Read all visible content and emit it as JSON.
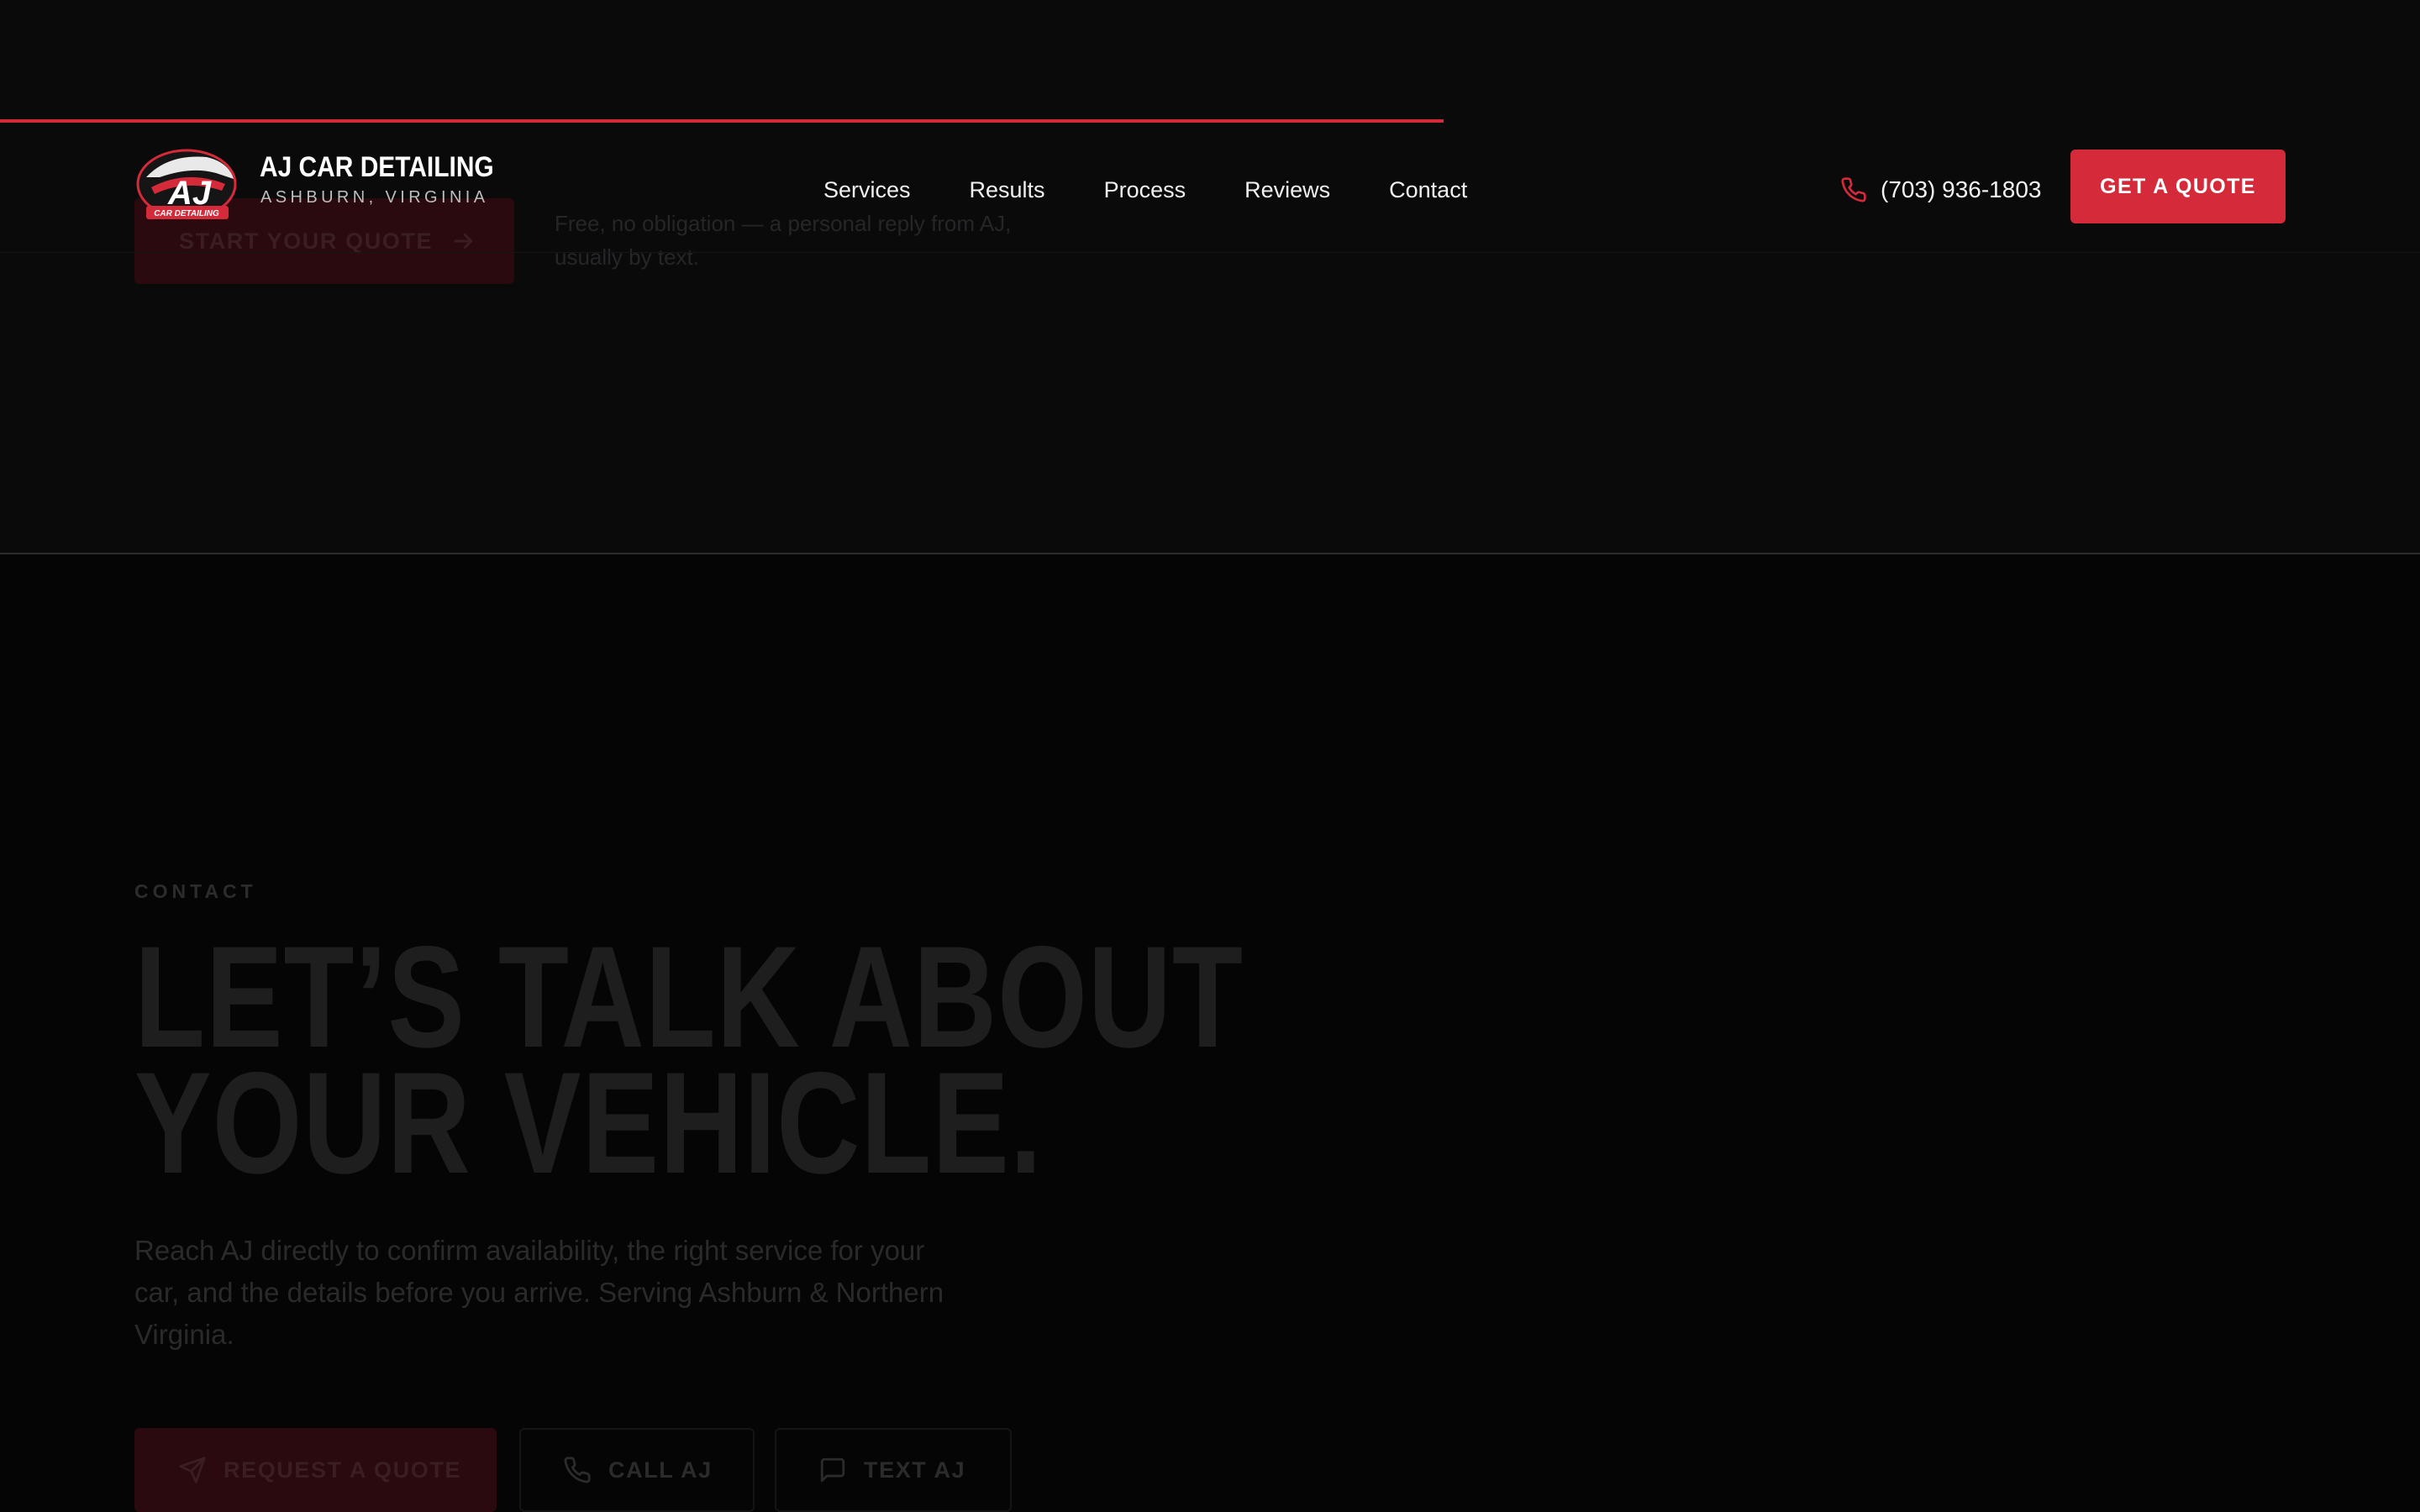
{
  "colors": {
    "accent": "#d42a3a",
    "background_top": "#0b0a0b",
    "background_bottom": "#050505"
  },
  "scroll_progress": 0.325,
  "header": {
    "brand_name": "AJ CAR DETAILING",
    "brand_location": "ASHBURN, VIRGINIA",
    "logo_icon": "aj-car-detailing-logo",
    "nav_items": [
      {
        "label": "Services"
      },
      {
        "label": "Results"
      },
      {
        "label": "Process"
      },
      {
        "label": "Reviews"
      },
      {
        "label": "Contact"
      }
    ],
    "phone_icon": "phone-icon",
    "phone": "(703) 936-1803",
    "cta_label": "GET A QUOTE"
  },
  "hero": {
    "start_quote_label": "START YOUR QUOTE",
    "start_quote_icon": "arrow-right-icon",
    "note": "Free, no obligation — a personal reply from AJ, usually by text."
  },
  "contact": {
    "eyebrow": "CONTACT",
    "headline_line1": "LET’S TALK ABOUT",
    "headline_line2": "YOUR VEHICLE.",
    "lead": "Reach AJ directly to confirm availability, the right service for your car, and the details before you arrive. Serving Ashburn & Northern Virginia.",
    "buttons": [
      {
        "label": "REQUEST A QUOTE",
        "icon": "send-icon"
      },
      {
        "label": "CALL AJ",
        "icon": "phone-icon"
      },
      {
        "label": "TEXT AJ",
        "icon": "message-icon"
      }
    ]
  }
}
